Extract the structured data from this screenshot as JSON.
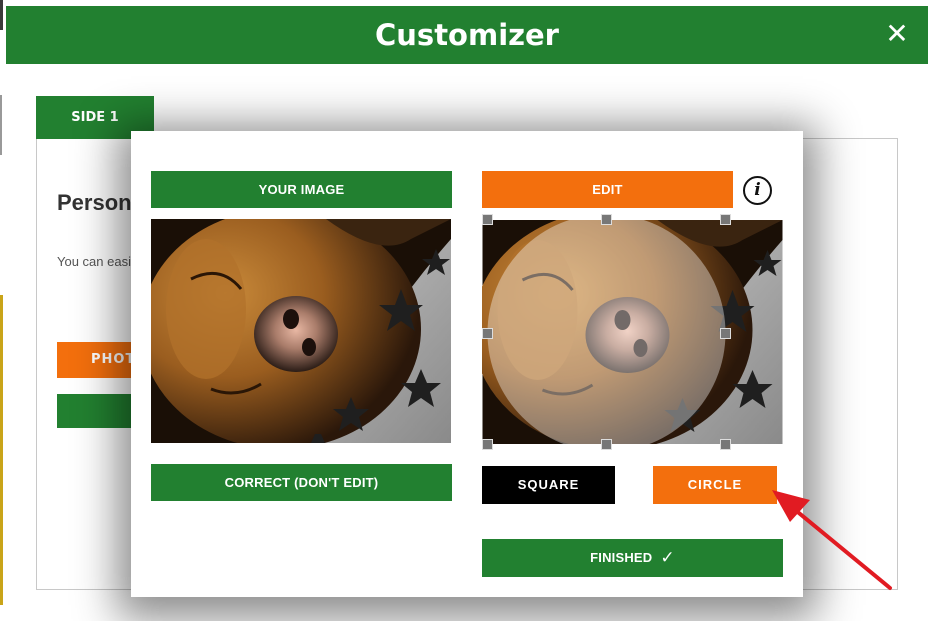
{
  "header": {
    "title": "Customizer",
    "close_label": "✕"
  },
  "tabs": [
    {
      "label": "SIDE 1"
    }
  ],
  "background": {
    "heading": "Personalised golf balls here",
    "text": "You can easily personalise golf balls below. personalise",
    "orange_button_label": "PHOTO"
  },
  "modal": {
    "your_image_label": "YOUR IMAGE",
    "edit_label": "EDIT",
    "info_icon": "info-icon",
    "correct_label": "CORRECT (DON'T EDIT)",
    "square_label": "SQUARE",
    "circle_label": "CIRCLE",
    "finished_label": "FINISHED",
    "finished_icon": "✓"
  },
  "colors": {
    "green": "#228030",
    "orange": "#f36f0d",
    "black": "#000000",
    "arrow": "#e11b22"
  }
}
